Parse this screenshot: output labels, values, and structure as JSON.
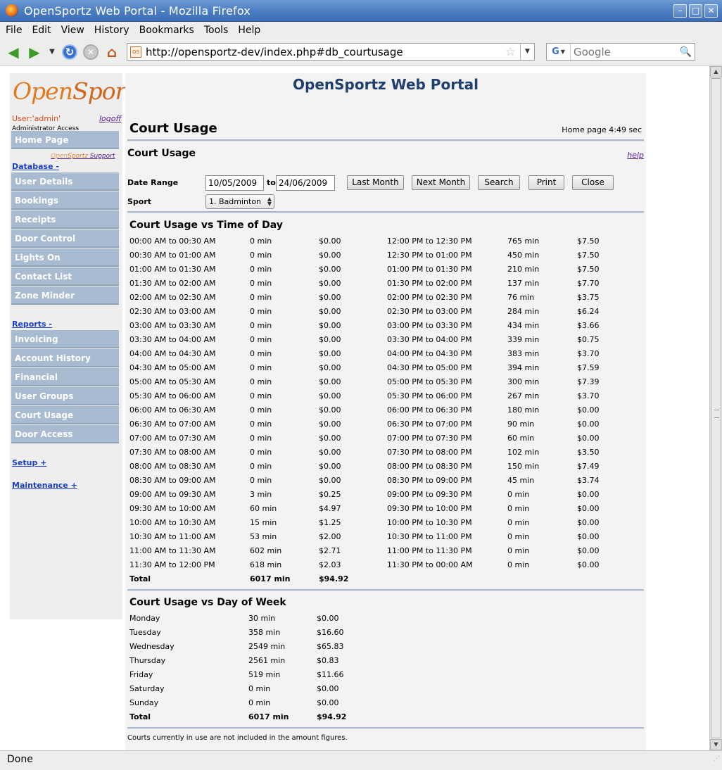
{
  "window": {
    "title": "OpenSportz Web Portal - Mozilla Firefox",
    "buttons": [
      "minimize",
      "maximize",
      "close"
    ]
  },
  "menubar": {
    "items": [
      {
        "label": "File",
        "accel": "F"
      },
      {
        "label": "Edit",
        "accel": "E"
      },
      {
        "label": "View",
        "accel": "V"
      },
      {
        "label": "History",
        "accel": "s"
      },
      {
        "label": "Bookmarks",
        "accel": "B"
      },
      {
        "label": "Tools",
        "accel": "T"
      },
      {
        "label": "Help",
        "accel": "H"
      }
    ]
  },
  "navbar": {
    "url": "http://opensportz-dev/index.php#db_courtusage",
    "search_placeholder": "Google",
    "search_engine": "G"
  },
  "sidebar": {
    "logo": {
      "part1": "Open",
      "part2": "Sportz"
    },
    "user_label": "User:'admin'",
    "logoff_label": "logoff",
    "access_label": "Administrator Access",
    "home_label": "Home Page",
    "support": {
      "open": "Open",
      "sportz": "Sportz",
      "support": " Support"
    },
    "database": {
      "label": "Database -",
      "items": [
        "User Details",
        "Bookings",
        "Receipts",
        "Door Control",
        "Lights On",
        "Contact List",
        "Zone Minder"
      ]
    },
    "reports": {
      "label": "Reports -",
      "items": [
        "Invoicing",
        "Account History",
        "Financial",
        "User Groups",
        "Court Usage",
        "Door Access"
      ]
    },
    "setup_label": "Setup +",
    "maintenance_label": "Maintenance +"
  },
  "main": {
    "portal_title": "OpenSportz Web Portal",
    "page_title": "Court Usage",
    "timing": "Home page 4:49 sec",
    "section_title": "Court Usage",
    "help_label": "help",
    "form": {
      "date_range_label": "Date Range",
      "date_from": "10/05/2009",
      "to_label": "to",
      "date_to": "24/06/2009",
      "sport_label": "Sport",
      "sport_value": "1. Badminton",
      "buttons": {
        "last_month": "Last Month",
        "next_month": "Next Month",
        "search": "Search",
        "print": "Print",
        "close": "Close"
      }
    },
    "time_of_day": {
      "title": "Court Usage vs Time of Day",
      "rows": [
        {
          "l_slot": "00:00 AM to 00:30 AM",
          "l_min": "0 min",
          "l_amt": "$0.00",
          "r_slot": "12:00 PM to 12:30 PM",
          "r_min": "765 min",
          "r_amt": "$7.50"
        },
        {
          "l_slot": "00:30 AM to 01:00 AM",
          "l_min": "0 min",
          "l_amt": "$0.00",
          "r_slot": "12:30 PM to 01:00 PM",
          "r_min": "450 min",
          "r_amt": "$7.50"
        },
        {
          "l_slot": "01:00 AM to 01:30 AM",
          "l_min": "0 min",
          "l_amt": "$0.00",
          "r_slot": "01:00 PM to 01:30 PM",
          "r_min": "210 min",
          "r_amt": "$7.50"
        },
        {
          "l_slot": "01:30 AM to 02:00 AM",
          "l_min": "0 min",
          "l_amt": "$0.00",
          "r_slot": "01:30 PM to 02:00 PM",
          "r_min": "137 min",
          "r_amt": "$7.70"
        },
        {
          "l_slot": "02:00 AM to 02:30 AM",
          "l_min": "0 min",
          "l_amt": "$0.00",
          "r_slot": "02:00 PM to 02:30 PM",
          "r_min": "76 min",
          "r_amt": "$3.75"
        },
        {
          "l_slot": "02:30 AM to 03:00 AM",
          "l_min": "0 min",
          "l_amt": "$0.00",
          "r_slot": "02:30 PM to 03:00 PM",
          "r_min": "284 min",
          "r_amt": "$6.24"
        },
        {
          "l_slot": "03:00 AM to 03:30 AM",
          "l_min": "0 min",
          "l_amt": "$0.00",
          "r_slot": "03:00 PM to 03:30 PM",
          "r_min": "434 min",
          "r_amt": "$3.66"
        },
        {
          "l_slot": "03:30 AM to 04:00 AM",
          "l_min": "0 min",
          "l_amt": "$0.00",
          "r_slot": "03:30 PM to 04:00 PM",
          "r_min": "339 min",
          "r_amt": "$0.75"
        },
        {
          "l_slot": "04:00 AM to 04:30 AM",
          "l_min": "0 min",
          "l_amt": "$0.00",
          "r_slot": "04:00 PM to 04:30 PM",
          "r_min": "383 min",
          "r_amt": "$3.70"
        },
        {
          "l_slot": "04:30 AM to 05:00 AM",
          "l_min": "0 min",
          "l_amt": "$0.00",
          "r_slot": "04:30 PM to 05:00 PM",
          "r_min": "394 min",
          "r_amt": "$7.59"
        },
        {
          "l_slot": "05:00 AM to 05:30 AM",
          "l_min": "0 min",
          "l_amt": "$0.00",
          "r_slot": "05:00 PM to 05:30 PM",
          "r_min": "300 min",
          "r_amt": "$7.39"
        },
        {
          "l_slot": "05:30 AM to 06:00 AM",
          "l_min": "0 min",
          "l_amt": "$0.00",
          "r_slot": "05:30 PM to 06:00 PM",
          "r_min": "267 min",
          "r_amt": "$3.70"
        },
        {
          "l_slot": "06:00 AM to 06:30 AM",
          "l_min": "0 min",
          "l_amt": "$0.00",
          "r_slot": "06:00 PM to 06:30 PM",
          "r_min": "180 min",
          "r_amt": "$0.00"
        },
        {
          "l_slot": "06:30 AM to 07:00 AM",
          "l_min": "0 min",
          "l_amt": "$0.00",
          "r_slot": "06:30 PM to 07:00 PM",
          "r_min": "90 min",
          "r_amt": "$0.00"
        },
        {
          "l_slot": "07:00 AM to 07:30 AM",
          "l_min": "0 min",
          "l_amt": "$0.00",
          "r_slot": "07:00 PM to 07:30 PM",
          "r_min": "60 min",
          "r_amt": "$0.00"
        },
        {
          "l_slot": "07:30 AM to 08:00 AM",
          "l_min": "0 min",
          "l_amt": "$0.00",
          "r_slot": "07:30 PM to 08:00 PM",
          "r_min": "102 min",
          "r_amt": "$3.50"
        },
        {
          "l_slot": "08:00 AM to 08:30 AM",
          "l_min": "0 min",
          "l_amt": "$0.00",
          "r_slot": "08:00 PM to 08:30 PM",
          "r_min": "150 min",
          "r_amt": "$7.49"
        },
        {
          "l_slot": "08:30 AM to 09:00 AM",
          "l_min": "0 min",
          "l_amt": "$0.00",
          "r_slot": "08:30 PM to 09:00 PM",
          "r_min": "45 min",
          "r_amt": "$3.74"
        },
        {
          "l_slot": "09:00 AM to 09:30 AM",
          "l_min": "3 min",
          "l_amt": "$0.25",
          "r_slot": "09:00 PM to 09:30 PM",
          "r_min": "0 min",
          "r_amt": "$0.00"
        },
        {
          "l_slot": "09:30 AM to 10:00 AM",
          "l_min": "60 min",
          "l_amt": "$4.97",
          "r_slot": "09:30 PM to 10:00 PM",
          "r_min": "0 min",
          "r_amt": "$0.00"
        },
        {
          "l_slot": "10:00 AM to 10:30 AM",
          "l_min": "15 min",
          "l_amt": "$1.25",
          "r_slot": "10:00 PM to 10:30 PM",
          "r_min": "0 min",
          "r_amt": "$0.00"
        },
        {
          "l_slot": "10:30 AM to 11:00 AM",
          "l_min": "53 min",
          "l_amt": "$2.00",
          "r_slot": "10:30 PM to 11:00 PM",
          "r_min": "0 min",
          "r_amt": "$0.00"
        },
        {
          "l_slot": "11:00 AM to 11:30 AM",
          "l_min": "602 min",
          "l_amt": "$2.71",
          "r_slot": "11:00 PM to 11:30 PM",
          "r_min": "0 min",
          "r_amt": "$0.00"
        },
        {
          "l_slot": "11:30 AM to 12:00 PM",
          "l_min": "618 min",
          "l_amt": "$2.03",
          "r_slot": "11:30 PM to 00:00 AM",
          "r_min": "0 min",
          "r_amt": "$0.00"
        }
      ],
      "total": {
        "label": "Total",
        "minutes": "6017 min",
        "amount": "$94.92"
      }
    },
    "day_of_week": {
      "title": "Court Usage vs Day of Week",
      "rows": [
        {
          "day": "Monday",
          "minutes": "30 min",
          "amount": "$0.00"
        },
        {
          "day": "Tuesday",
          "minutes": "358 min",
          "amount": "$16.60"
        },
        {
          "day": "Wednesday",
          "minutes": "2549 min",
          "amount": "$65.83"
        },
        {
          "day": "Thursday",
          "minutes": "2561 min",
          "amount": "$0.83"
        },
        {
          "day": "Friday",
          "minutes": "519 min",
          "amount": "$11.66"
        },
        {
          "day": "Saturday",
          "minutes": "0 min",
          "amount": "$0.00"
        },
        {
          "day": "Sunday",
          "minutes": "0 min",
          "amount": "$0.00"
        }
      ],
      "total": {
        "label": "Total",
        "minutes": "6017 min",
        "amount": "$94.92"
      }
    },
    "footnote": "Courts currently in use are not included in the amount figures."
  },
  "statusbar": {
    "text": "Done"
  }
}
